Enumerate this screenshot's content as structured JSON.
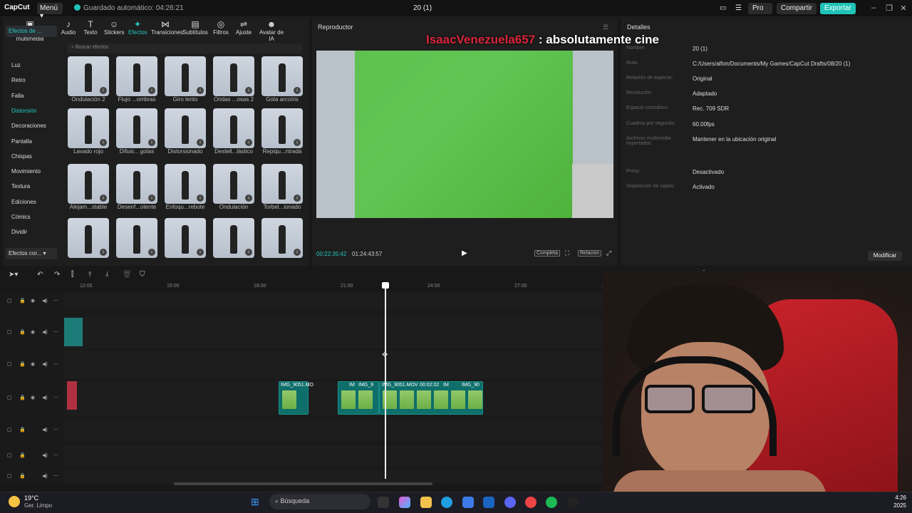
{
  "topbar": {
    "app_name": "CapCut",
    "menu_label": "Menú",
    "autosave": "Guardado automático: 04:26:21",
    "project_title": "20 (1)",
    "pro_label": "Pro",
    "share_label": "Compartir",
    "export_label": "Exportar",
    "accent": "#1fc3b7"
  },
  "tool_tabs": [
    {
      "label": "Archivos multimedia",
      "icon": "media-icon"
    },
    {
      "label": "Audio",
      "icon": "audio-icon"
    },
    {
      "label": "Texto",
      "icon": "text-icon"
    },
    {
      "label": "Stickers",
      "icon": "sticker-icon"
    },
    {
      "label": "Efectos",
      "icon": "effects-icon",
      "active": true
    },
    {
      "label": "Transiciones",
      "icon": "transition-icon"
    },
    {
      "label": "Subtítulos",
      "icon": "subtitles-icon"
    },
    {
      "label": "Filtros",
      "icon": "filter-icon"
    },
    {
      "label": "Ajuste",
      "icon": "adjust-icon"
    },
    {
      "label": "Avatar de IA",
      "icon": "avatar-icon"
    }
  ],
  "categories": {
    "top": "Efectos de ...",
    "items": [
      "Luz",
      "Retro",
      "Falla",
      "Distorsión",
      "Decoraciones",
      "Pantalla",
      "Chispas",
      "Movimiento",
      "Textura",
      "Ediciones",
      "Cómics",
      "Dividir"
    ],
    "active": "Distorsión",
    "bottom": "Efectos cor..."
  },
  "search_placeholder": "Buscar efectos",
  "effects": [
    "Ondulación 2",
    "Flujo ...ombras",
    "Giro lento",
    "Ondas ...osas 2",
    "Gota arcoíris",
    "Lavado rojo",
    "Difusi... gotas",
    "Distorsionado",
    "Destell...lástico",
    "Repiqu...ntrada",
    "Alejam...stable",
    "Desenf...otente",
    "Enfoqu...rebote",
    "Ondulación",
    "Torbel...ionado"
  ],
  "player": {
    "title": "Reproductor",
    "current": "00:22:35:42",
    "duration": "01:24:43:57",
    "full_label": "Completa",
    "ratio_label": "Relación"
  },
  "chat": {
    "user": "IsaacVenezuela657",
    "message": ": absolutamente cine"
  },
  "details": {
    "title": "Detalles",
    "rows": [
      {
        "k": "Nombre:",
        "v": "20 (1)"
      },
      {
        "k": "Ruta:",
        "v": "C:/Users/alfon/Documents/My Games/CapCut Drafts/08/20 (1)"
      },
      {
        "k": "Relación de aspecto:",
        "v": "Original"
      },
      {
        "k": "Resolución:",
        "v": "Adaptado"
      },
      {
        "k": "Espacio cromático:",
        "v": "Rec. 709 SDR"
      },
      {
        "k": "Cuadros por segundo:",
        "v": "60.00fps"
      },
      {
        "k": "Archivos multimedia importados:",
        "v": "Mantener en la ubicación original"
      },
      {
        "k": "Proxy:",
        "v": "Desactivado"
      },
      {
        "k": "Disposición de capas:",
        "v": "Activado"
      }
    ],
    "modify_label": "Modificar"
  },
  "timeline": {
    "ticks": [
      "12:00",
      "15:00",
      "18:00",
      "21:00",
      "24:00",
      "27:00",
      "30:00",
      "36:00",
      "39:00"
    ],
    "clips": [
      "IMG_9051.MO",
      "IM",
      "IMG_9",
      "IMG_9051.MOV",
      "00:02:02",
      "IM",
      "IMG_90"
    ]
  },
  "taskbar": {
    "temp": "19°C",
    "weather": "Ger. Limpo",
    "search": "Búsqueda",
    "time": "4:26",
    "date": "2025"
  }
}
